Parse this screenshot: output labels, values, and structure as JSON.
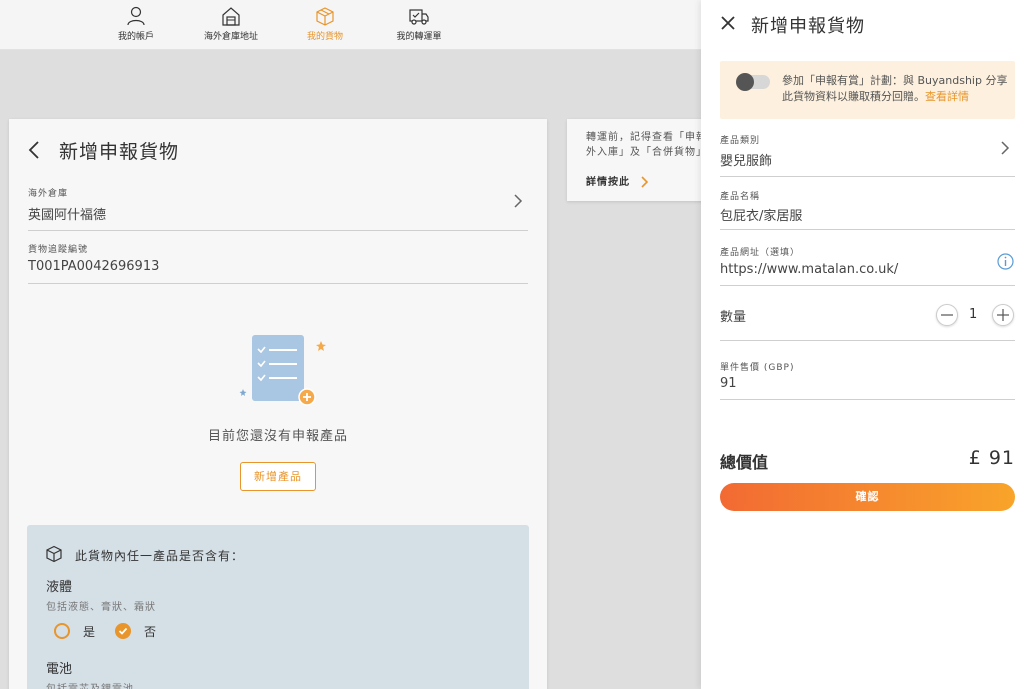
{
  "nav": {
    "items": [
      {
        "label": "我的帳戶",
        "icon": "user-icon"
      },
      {
        "label": "海外倉庫地址",
        "icon": "warehouse-icon"
      },
      {
        "label": "我的貨物",
        "icon": "package-icon"
      },
      {
        "label": "我的轉運單",
        "icon": "truck-icon"
      }
    ],
    "active_index": 2,
    "accent_color": "#e8952b"
  },
  "main": {
    "title": "新增申報貨物",
    "warehouse": {
      "label": "海外倉庫",
      "value": "英國阿什福德"
    },
    "tracking": {
      "label": "貨物追蹤編號",
      "value": "T001PA0042696913"
    },
    "empty_text": "目前您還沒有申報產品",
    "add_button": "新增產品",
    "question": {
      "title": "此貨物內任一產品是否含有：",
      "items": [
        {
          "title": "液體",
          "subtitle": "包括液態、膏狀、霜狀",
          "yes": "是",
          "no": "否",
          "selected": "否"
        },
        {
          "title": "電池",
          "subtitle": "包括電芯及鋰電池"
        }
      ]
    }
  },
  "info": {
    "text_line1": "轉運前，記得查看「申報",
    "text_line2": "外入庫」及「合併貨物」",
    "link": "詳情按此"
  },
  "drawer": {
    "title": "新增申報貨物",
    "promo": {
      "text": "參加「申報有賞」計劃：與 Buyandship 分享此貨物資料以賺取積分回贈。",
      "link": "查看詳情",
      "toggle_on": false
    },
    "category": {
      "label": "產品類別",
      "value": "嬰兒服飾"
    },
    "name": {
      "label": "產品名稱",
      "value": "包屁衣/家居服"
    },
    "url": {
      "label": "產品網址（選填）",
      "value": "https://www.matalan.co.uk/"
    },
    "quantity": {
      "label": "數量",
      "value": "1"
    },
    "price": {
      "label": "單件售價 (GBP)",
      "value": "91"
    },
    "total": {
      "label": "總價值",
      "value": "£ 91"
    },
    "confirm": "確認"
  }
}
